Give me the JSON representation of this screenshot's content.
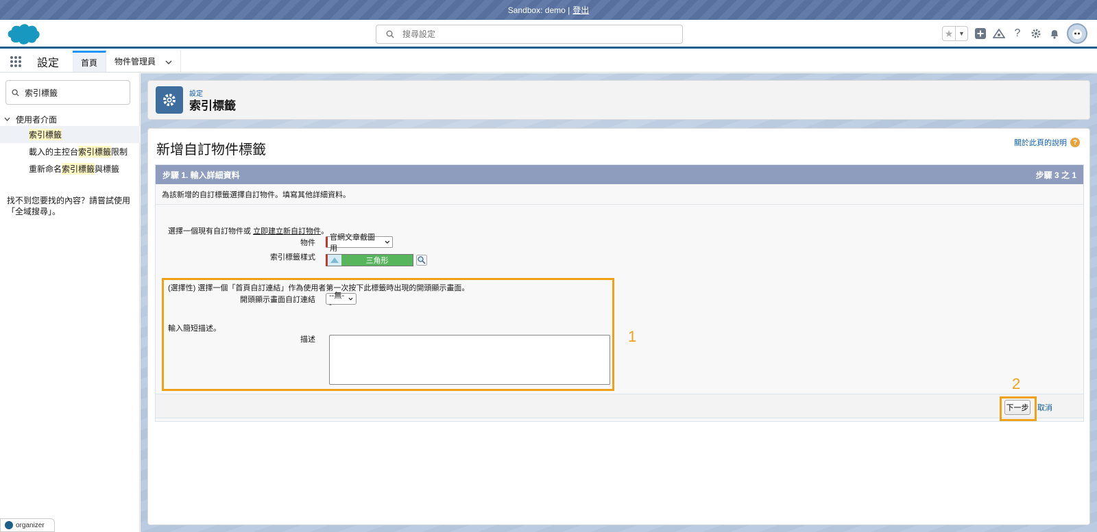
{
  "sandbox": {
    "label": "Sandbox: demo |",
    "logout": "登出"
  },
  "header": {
    "search_placeholder": "搜尋設定"
  },
  "app_nav": {
    "app_name": "設定",
    "tabs": [
      {
        "label": "首頁"
      },
      {
        "label": "物件管理員"
      }
    ]
  },
  "sidebar": {
    "quick_find_value": "索引標籤",
    "section": "使用者介面",
    "items": [
      {
        "pre": "",
        "hl": "索引標籤",
        "post": ""
      },
      {
        "pre": "載入的主控台",
        "hl": "索引標籤",
        "post": "限制"
      },
      {
        "pre": "重新命名",
        "hl": "索引標籤",
        "post": "與標籤"
      }
    ],
    "note": "找不到您要找的內容？請嘗試使用「全域搜尋」。",
    "organizer": "organizer"
  },
  "setup_header": {
    "breadcrumb": "設定",
    "title": "索引標籤"
  },
  "page": {
    "title": "新增自訂物件標籤",
    "help_link": "關於此頁的說明",
    "step_title": "步驟 1. 輸入詳細資料",
    "step_count": "步驟 3 之 1",
    "step_desc": "為該新增的自訂標籤選擇自訂物件。填寫其他詳細資料。",
    "choose_object_pre": "選擇一個現有自訂物件或 ",
    "choose_object_link": "立即建立新自訂物件",
    "choose_object_post": "。",
    "object_label": "物件",
    "object_value": "官網文章截圖用",
    "tab_style_label": "索引標籤樣式",
    "tab_style_value": "三角形",
    "optional_text": "(選擇性) 選擇一個「首頁自訂連結」作為使用者第一次按下此標籤時出現的開頭顯示畫面。",
    "splash_label": "開頭顯示畫面自訂連結",
    "splash_value": "--無--",
    "short_desc_text": "輸入簡短描述。",
    "desc_label": "描述",
    "desc_value": "",
    "next_button": "下一步",
    "cancel_link": "取消"
  },
  "callouts": {
    "one": "1",
    "two": "2"
  },
  "colors": {
    "accent": "#f0a11a",
    "step_bar": "#8e9dbe",
    "brand": "#1b96ff",
    "required": "#c23934"
  }
}
